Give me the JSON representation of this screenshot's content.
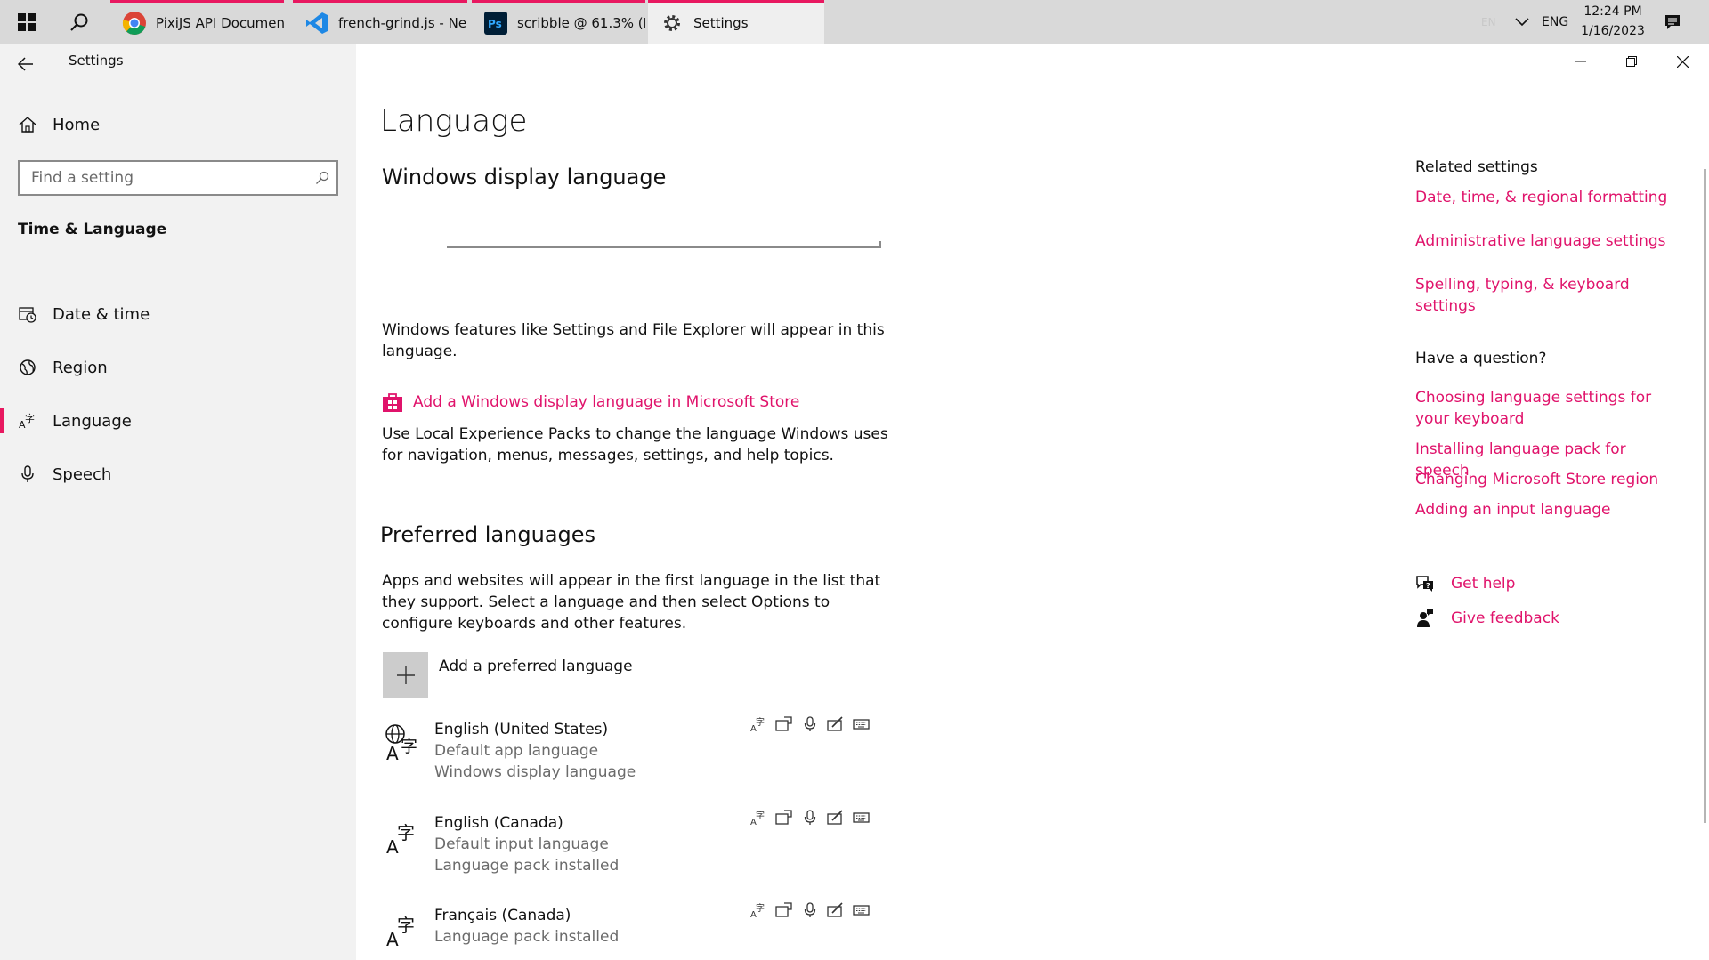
{
  "taskbar": {
    "apps": [
      {
        "label": "PixiJS API Documen...",
        "icon": "chrome-icon"
      },
      {
        "label": "french-grind.js - Ne...",
        "icon": "vscode-icon"
      },
      {
        "label": "scribble @ 61.3% (L...",
        "icon": "photoshop-icon"
      },
      {
        "label": "Settings",
        "icon": "gear-icon"
      }
    ],
    "tray": {
      "ime": "EN",
      "lang": "ENG",
      "time": "12:24 PM",
      "date": "1/16/2023"
    }
  },
  "sidebar": {
    "app_title": "Settings",
    "home": "Home",
    "search_placeholder": "Find a setting",
    "section": "Time & Language",
    "items": [
      {
        "label": "Date & time"
      },
      {
        "label": "Region"
      },
      {
        "label": "Language"
      },
      {
        "label": "Speech"
      }
    ]
  },
  "main": {
    "title": "Language",
    "display_heading": "Windows display language",
    "display_desc": "Windows features like Settings and File Explorer will appear in this language.",
    "store_link": "Add a Windows display language in Microsoft Store",
    "lxp_desc": "Use Local Experience Packs to change the language Windows uses for navigation, menus, messages, settings, and help topics.",
    "preferred_heading": "Preferred languages",
    "preferred_desc": "Apps and websites will appear in the first language in the list that they support. Select a language and then select Options to configure keyboards and other features.",
    "add_label": "Add a preferred language",
    "languages": [
      {
        "name": "English (United States)",
        "sub1": "Default app language",
        "sub2": "Windows display language"
      },
      {
        "name": "English (Canada)",
        "sub1": "Default input language",
        "sub2": "Language pack installed"
      },
      {
        "name": "Français (Canada)",
        "sub1": "Language pack installed"
      }
    ]
  },
  "right": {
    "related_heading": "Related settings",
    "related": [
      "Date, time, & regional formatting",
      "Administrative language settings",
      "Spelling, typing, & keyboard settings"
    ],
    "question_heading": "Have a question?",
    "questions": [
      "Choosing language settings for your keyboard",
      "Installing language pack for speech",
      "Changing Microsoft Store region",
      "Adding an input language"
    ],
    "get_help": "Get help",
    "give_feedback": "Give feedback"
  },
  "colors": {
    "accent": "#e0136b",
    "taskbar": "#d9d9d9",
    "sidebar": "#f2f2f2"
  }
}
